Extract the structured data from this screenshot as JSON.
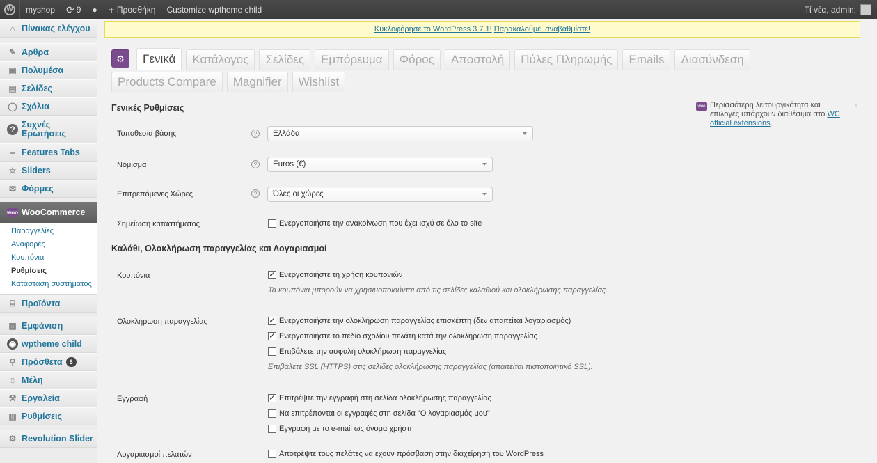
{
  "adminbar": {
    "site_name": "myshop",
    "updates_count": "9",
    "add_new": "Προσθήκη",
    "customize": "Customize wptheme child",
    "greeting": "Τί νέα, admin;"
  },
  "sidebar": {
    "items": [
      {
        "label": "Πίνακας ελέγχου",
        "icon": "dashboard-icon"
      },
      {
        "label": "Άρθρα",
        "icon": "pin-icon"
      },
      {
        "label": "Πολυμέσα",
        "icon": "media-icon"
      },
      {
        "label": "Σελίδες",
        "icon": "pages-icon"
      },
      {
        "label": "Σχόλια",
        "icon": "comments-icon"
      },
      {
        "label": "Συχνές Ερωτήσεις",
        "icon": "question-icon"
      },
      {
        "label": "Features Tabs",
        "icon": "tabs-icon"
      },
      {
        "label": "Sliders",
        "icon": "star-icon"
      },
      {
        "label": "Φόρμες",
        "icon": "forms-icon"
      },
      {
        "label": "WooCommerce",
        "icon": "woo-icon"
      },
      {
        "label": "Προϊόντα",
        "icon": "products-icon"
      },
      {
        "label": "Εμφάνιση",
        "icon": "appearance-icon"
      },
      {
        "label": "wptheme child",
        "icon": "theme-icon"
      },
      {
        "label": "Πρόσθετα",
        "icon": "plugins-icon",
        "badge": "6"
      },
      {
        "label": "Μέλη",
        "icon": "users-icon"
      },
      {
        "label": "Εργαλεία",
        "icon": "tools-icon"
      },
      {
        "label": "Ρυθμίσεις",
        "icon": "settings-icon"
      },
      {
        "label": "Revolution Slider",
        "icon": "slider-icon"
      }
    ],
    "woo_submenu": [
      "Παραγγελίες",
      "Αναφορές",
      "Κουπόνια",
      "Ρυθμίσεις",
      "Κατάσταση συστήματος"
    ]
  },
  "notice": {
    "text": "Κυκλοφόρησε το WordPress 3.7.1!",
    "link": "Παρακαλούμε, αναβαθμίστε!"
  },
  "tabs": {
    "row1": [
      "Γενικά",
      "Κατάλογος",
      "Σελίδες",
      "Εμπόρευμα",
      "Φόρος",
      "Αποστολή",
      "Πύλες Πληρωμής",
      "Emails",
      "Διασύνδεση"
    ],
    "row2": [
      "Products Compare",
      "Magnifier",
      "Wishlist"
    ]
  },
  "general": {
    "title": "Γενικές Ρυθμίσεις",
    "base_location_label": "Τοποθεσία βάσης",
    "base_location_value": "Ελλάδα",
    "currency_label": "Νόμισμα",
    "currency_value": "Euros (€)",
    "countries_label": "Επιτρεπόμενες Χώρες",
    "countries_value": "Όλες οι χώρες",
    "notice_label": "Σημείωση καταστήματος",
    "notice_cb": "Ενεργοποιήστε την ανακοίνωση που έχει ισχύ σε όλο το site"
  },
  "cart": {
    "title": "Καλάθι, Ολοκλήρωση παραγγελίας και Λογαριασμοί",
    "coupons_label": "Κουπόνια",
    "coupons_cb": "Ενεργοποιήστε τη χρήση κουπονιών",
    "coupons_desc": "Τα κουπόνια μπορούν να χρησιμοποιούνται από τις σελίδες καλαθιού και ολοκλήρωσης παραγγελίας.",
    "checkout_label": "Ολοκλήρωση παραγγελίας",
    "checkout_cb1": "Ενεργοποιήστε την ολοκλήρωση παραγγελίας επισκέπτη (δεν απαιτείται λογαριασμός)",
    "checkout_cb2": "Ενεργοποιήστε το πεδίο σχολίου πελάτη κατά την ολοκλήρωση παραγγελίας",
    "checkout_cb3": "Επιβάλετε την ασφαλή ολοκλήρωση παραγγελίας",
    "checkout_desc": "Επιβάλετε SSL (HTTPS) στις σελίδες ολοκλήρωσης παραγγελίας (απαιτείται πιστοποιητικό SSL).",
    "reg_label": "Εγγραφή",
    "reg_cb1": "Επιτρέψτε την εγγραφή στη σελίδα ολοκλήρωσης παραγγελίας",
    "reg_cb2": "Να επιτρέπονται οι εγγραφές στη σελίδα \"Ο λογαριασμός μου\"",
    "reg_cb3": "Εγγραφή με το e-mail ως όνομα χρήστη",
    "accounts_label": "Λογαριασμοί πελατών",
    "accounts_cb": "Αποτρέψτε τους πελάτες να έχουν πρόσβαση στην διαχείρηση του WordPress"
  },
  "promo": {
    "text": "Περισσότερη λειτουργικότητα και επιλογές υπάρχουν διαθέσιμα στο",
    "link": "WC official extensions",
    "close": "x"
  }
}
